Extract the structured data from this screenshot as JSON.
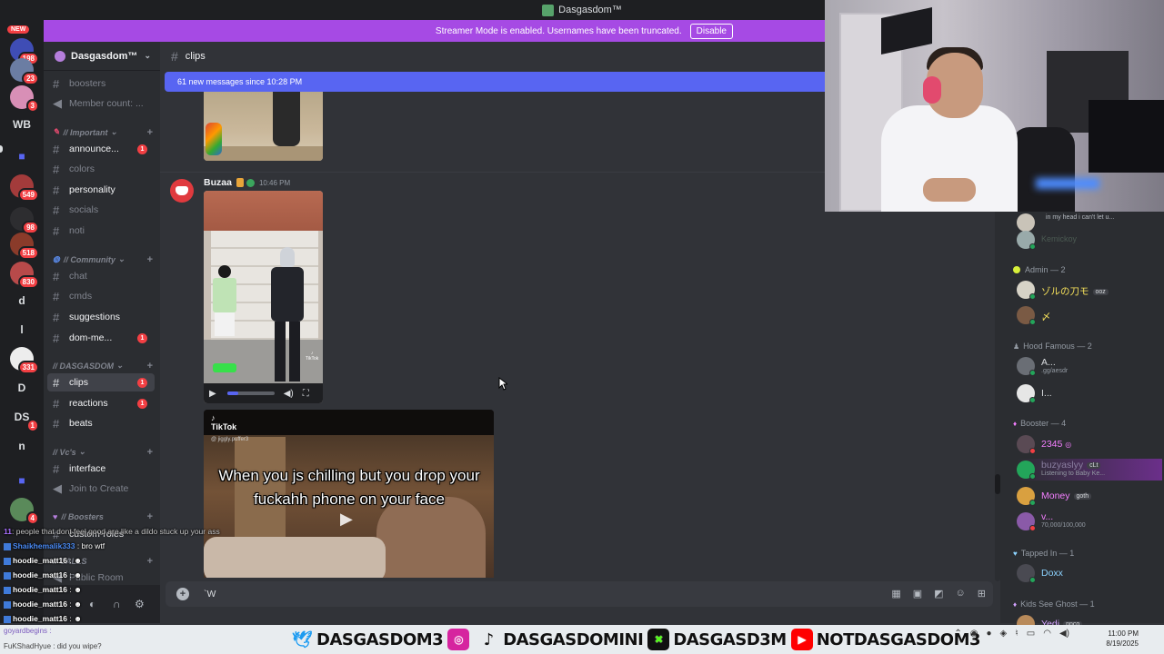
{
  "window": {
    "title": "Dasgasdom™"
  },
  "banner": {
    "text": "Streamer Mode is enabled. Usernames have been truncated.",
    "button": "Disable"
  },
  "rail": {
    "new_label": "NEW",
    "items": [
      {
        "label": "",
        "badge": "198"
      },
      {
        "label": "",
        "badge": "23"
      },
      {
        "label": "",
        "badge": "3"
      },
      {
        "label": "WB",
        "badge": ""
      },
      {
        "label": "",
        "badge": ""
      },
      {
        "label": "",
        "badge": "549"
      },
      {
        "label": "",
        "badge": "98"
      },
      {
        "label": "",
        "badge": "518"
      },
      {
        "label": "",
        "badge": "830"
      },
      {
        "label": "d",
        "badge": ""
      },
      {
        "label": "l",
        "badge": ""
      },
      {
        "label": "",
        "badge": "331"
      },
      {
        "label": "D",
        "badge": ""
      },
      {
        "label": "DS",
        "badge": "1"
      },
      {
        "label": "n",
        "badge": ""
      },
      {
        "label": "",
        "badge": ""
      },
      {
        "label": "",
        "badge": "4"
      }
    ]
  },
  "server": {
    "name": "Dasgasdom™"
  },
  "sidebar": {
    "channels": [
      {
        "name": "boosters",
        "type": "text"
      },
      {
        "name": "Member count: ...",
        "type": "voice"
      },
      {
        "name": "announce...",
        "type": "text",
        "badge": "1",
        "bold": true
      },
      {
        "name": "colors",
        "type": "text"
      },
      {
        "name": "personality",
        "type": "text",
        "bold": true
      },
      {
        "name": "socials",
        "type": "text"
      },
      {
        "name": "noti",
        "type": "text"
      },
      {
        "name": "chat",
        "type": "text"
      },
      {
        "name": "cmds",
        "type": "text"
      },
      {
        "name": "suggestions",
        "type": "text",
        "bold": true
      },
      {
        "name": "dom-me...",
        "type": "text",
        "badge": "1",
        "bold": true
      },
      {
        "name": "clips",
        "type": "text",
        "badge": "1",
        "active": true
      },
      {
        "name": "reactions",
        "type": "text",
        "badge": "1",
        "bold": true
      },
      {
        "name": "beats",
        "type": "text",
        "bold": true
      },
      {
        "name": "interface",
        "type": "text",
        "bold": true
      },
      {
        "name": "Join to Create",
        "type": "voice"
      },
      {
        "name": "custom-roles",
        "type": "text",
        "bold": true
      },
      {
        "name": "Public Room",
        "type": "voice"
      }
    ],
    "categories": {
      "important": "// Important",
      "community": "// Community",
      "dasgasdom": "// DASGASDOM",
      "vcs": "// Vc's",
      "boosters": "// Boosters",
      "calls": "// CALLS"
    }
  },
  "chat": {
    "channel_name": "clips",
    "new_messages": "61 new messages since 10:28 PM",
    "message": {
      "author": "Buzaa",
      "time": "10:46 PM",
      "tiktok_label": "TikTok",
      "video2_logo": "TikTok",
      "video2_user": "@ jiggly.puffer3",
      "video2_caption": "When you js chilling but you drop your fuckahh phone on your face"
    },
    "input_value": "`W"
  },
  "members": {
    "groups": [
      {
        "title": "Admin — 2",
        "color": "#ffe45c"
      },
      {
        "title": "Hood Famous — 2",
        "color": "#e8e8e8"
      },
      {
        "title": "Booster — 4",
        "color": "#f47fff"
      },
      {
        "title": "Tapped In — 1",
        "color": "#8cd3ff"
      },
      {
        "title": "Kids See Ghost — 1",
        "color": "#d3a2ff"
      }
    ],
    "top_status": "in my head i can't let u...",
    "top_name": "Kemickoy",
    "admin": [
      {
        "name": "ゾルの刀モ",
        "tag": "ooz",
        "color": "#f5e05a"
      },
      {
        "name": "〆",
        "tag": "",
        "color": "#f5e05a"
      }
    ],
    "hood": [
      {
        "name": "A...",
        "sub": ".gg/aesdr",
        "color": "#ffffff"
      },
      {
        "name": "I...",
        "sub": "",
        "color": "#ffffff"
      }
    ],
    "booster": [
      {
        "name": "2345",
        "sub": "",
        "color": "#f47fff"
      },
      {
        "name": "buzyaslyy",
        "tag": "cLt",
        "sub": "Listening to Baby Ke...",
        "color": "#f47fff"
      },
      {
        "name": "Money",
        "tag": "goth",
        "sub": "",
        "color": "#f47fff"
      },
      {
        "name": "v...",
        "sub": "70,000/100,000",
        "color": "#f47fff"
      }
    ],
    "tapped": [
      {
        "name": "Doxx",
        "color": "#8cd3ff"
      }
    ],
    "ghost": [
      {
        "name": "Yedi",
        "tag": "nnco",
        "color": "#d3a2ff"
      }
    ]
  },
  "overlay_chat": [
    {
      "user": "11",
      "text": ": people that dont feel good are like a dildo stuck up your ass",
      "color": "#a970ff"
    },
    {
      "user": "Shaikhemalik333",
      "text": ": bro wtf",
      "color": "#4b8cf7"
    },
    {
      "user": "hoodie_matt16",
      "text": ":",
      "color": "#ffffff"
    },
    {
      "user": "hoodie_matt16",
      "text": ":",
      "color": "#ffffff"
    },
    {
      "user": "hoodie_matt16",
      "text": ":",
      "color": "#ffffff"
    },
    {
      "user": "hoodie_matt16",
      "text": ":",
      "color": "#ffffff"
    },
    {
      "user": "hoodie_matt16",
      "text": ":",
      "color": "#ffffff"
    }
  ],
  "stream_bar": {
    "left1": "goyardbegins :",
    "left2": "FuKShadHyue : did you wipe?",
    "socials": [
      {
        "icon": "twitter-icon",
        "handle": "DASGASDOM3",
        "color": "#1d9bf0"
      },
      {
        "icon": "instagram-icon",
        "handle": "DASGASDOMINI",
        "color": "#d6249f"
      },
      {
        "icon": "tiktok-icon",
        "handle": "DASGASD3M",
        "color": "#111111"
      },
      {
        "icon": "kick-icon",
        "handle": "NOTDASGASDOM3",
        "color": "#53fc18"
      },
      {
        "icon": "youtube-icon",
        "handle": "",
        "color": "#ff0000"
      }
    ],
    "youtube_handle": "NOTDASGASDOM3",
    "clock_time": "11:00 PM",
    "clock_date": "8/19/2025"
  }
}
